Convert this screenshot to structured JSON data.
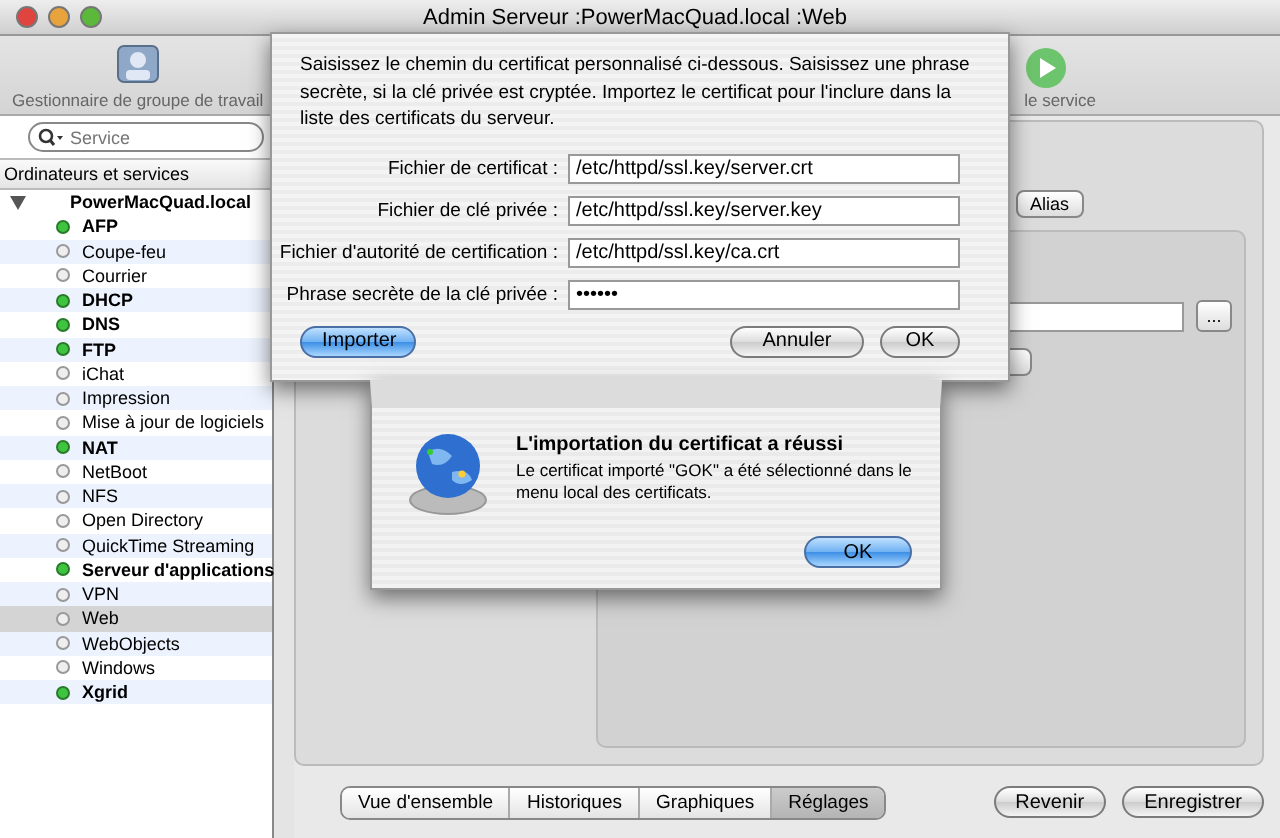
{
  "window": {
    "title": "Admin Serveur :PowerMacQuad.local :Web"
  },
  "toolbar": [
    {
      "label": "Gestionnaire de groupe de travail",
      "kind": "workgroup"
    },
    {
      "label": "le service",
      "kind": "start"
    }
  ],
  "search": {
    "placeholder": "Service"
  },
  "sidebar": {
    "header": "Ordinateurs et services",
    "tree": [
      {
        "label": "PowerMacQuad.local",
        "expanded": true,
        "children": [
          {
            "label": "AFP",
            "running": true,
            "selected": false
          },
          {
            "label": "Coupe-feu",
            "running": false,
            "selected": false
          },
          {
            "label": "Courrier",
            "running": false,
            "selected": false
          },
          {
            "label": "DHCP",
            "running": true,
            "selected": false
          },
          {
            "label": "DNS",
            "running": true,
            "selected": false
          },
          {
            "label": "FTP",
            "running": true,
            "selected": false
          },
          {
            "label": "iChat",
            "running": false,
            "selected": false
          },
          {
            "label": "Impression",
            "running": false,
            "selected": false
          },
          {
            "label": "Mise à jour de logiciels",
            "running": false,
            "selected": false
          },
          {
            "label": "NAT",
            "running": true,
            "selected": false
          },
          {
            "label": "NetBoot",
            "running": false,
            "selected": false
          },
          {
            "label": "NFS",
            "running": false,
            "selected": false
          },
          {
            "label": "Open Directory",
            "running": false,
            "selected": false
          },
          {
            "label": "QuickTime Streaming",
            "running": false,
            "selected": false
          },
          {
            "label": "Serveur d'applications",
            "running": true,
            "selected": false
          },
          {
            "label": "VPN",
            "running": false,
            "selected": false
          },
          {
            "label": "Web",
            "running": false,
            "selected": true
          },
          {
            "label": "WebObjects",
            "running": false,
            "selected": false
          },
          {
            "label": "Windows",
            "running": false,
            "selected": false
          },
          {
            "label": "Xgrid",
            "running": true,
            "selected": false
          }
        ]
      }
    ]
  },
  "main": {
    "tab": "Alias",
    "more_button": "...",
    "bottom_tabs": [
      {
        "label": "Vue d'ensemble",
        "selected": false
      },
      {
        "label": "Historiques",
        "selected": false
      },
      {
        "label": "Graphiques",
        "selected": false
      },
      {
        "label": "Réglages",
        "selected": true
      }
    ],
    "buttons": [
      "Revenir",
      "Enregistrer"
    ]
  },
  "sheet": {
    "message": "Saisissez le chemin du certificat personnalisé ci-dessous. Saisissez une phrase secrète, si la clé privée est cryptée. Importez le certificat pour l'inclure dans la liste des certificats du serveur.",
    "fields": [
      {
        "label": "Fichier de certificat :",
        "value": "/etc/httpd/ssl.key/server.crt"
      },
      {
        "label": "Fichier de clé privée :",
        "value": "/etc/httpd/ssl.key/server.key"
      },
      {
        "label": "Fichier d'autorité de certification :",
        "value": "/etc/httpd/ssl.key/ca.crt"
      },
      {
        "label": "Phrase secrète de la clé privée :",
        "value": "••••••"
      }
    ],
    "buttons": [
      {
        "label": "Importer",
        "default": true
      },
      {
        "label": "Annuler",
        "default": false
      },
      {
        "label": "OK",
        "default": false
      }
    ]
  },
  "alert": {
    "title": "L'importation du certificat a réussi",
    "message": "Le certificat importé \"GOK\" a été sélectionné dans le menu local des certificats.",
    "button": {
      "label": "OK",
      "default": true
    }
  }
}
